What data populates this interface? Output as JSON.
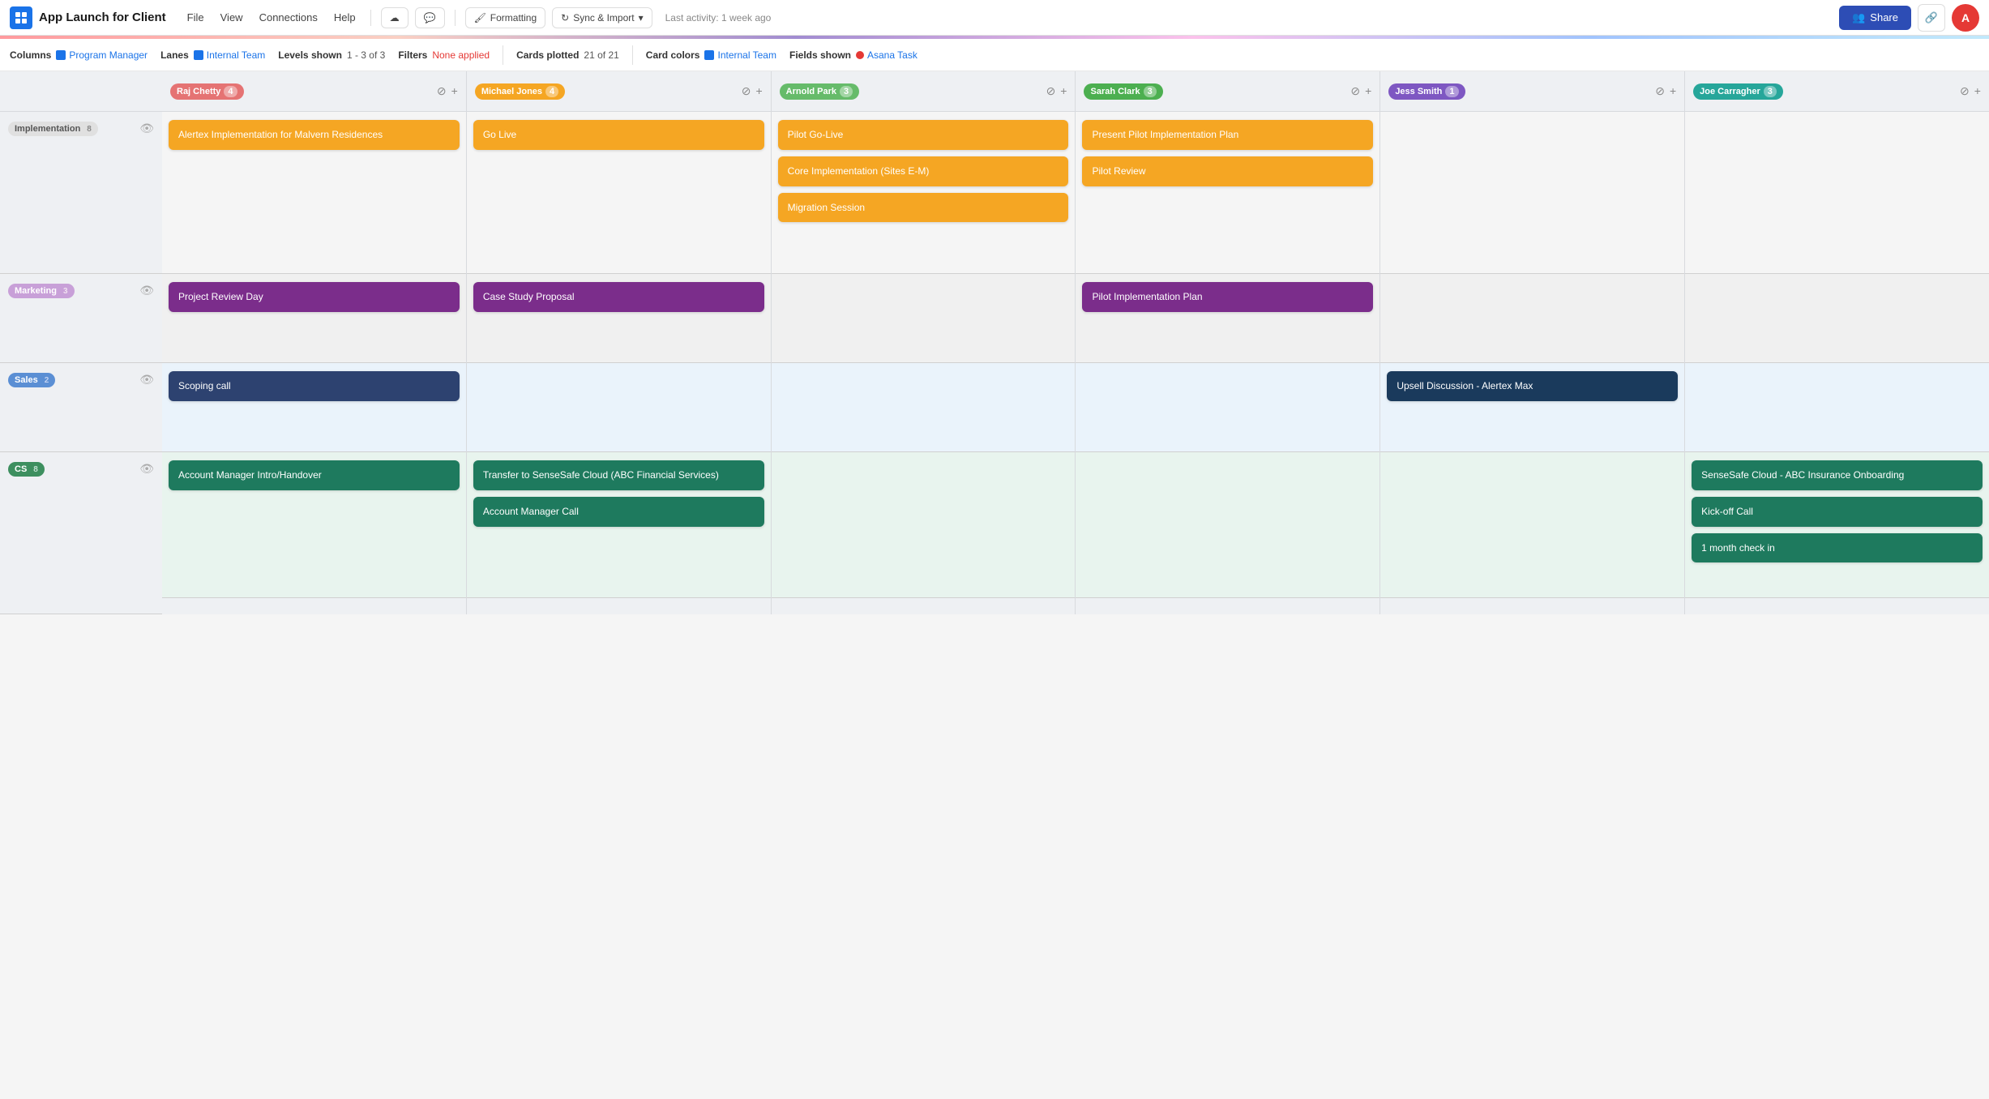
{
  "app": {
    "logo_text": "A",
    "title": "App Launch for Client",
    "menu": [
      "File",
      "View",
      "Connections",
      "Help"
    ],
    "formatting_btn": "Formatting",
    "sync_btn": "Sync & Import",
    "last_activity": "Last activity:  1 week ago",
    "share_btn": "Share",
    "avatar": "A"
  },
  "toolbar": {
    "columns_label": "Columns",
    "columns_value": "Program Manager",
    "lanes_label": "Lanes",
    "lanes_value": "Internal Team",
    "levels_label": "Levels shown",
    "levels_value": "1 - 3 of 3",
    "filters_label": "Filters",
    "filters_value": "None applied",
    "cards_label": "Cards plotted",
    "cards_value": "21 of 21",
    "card_colors_label": "Card colors",
    "card_colors_value": "Internal Team",
    "fields_label": "Fields shown",
    "fields_value": "Asana Task"
  },
  "columns": [
    {
      "id": "raj",
      "name": "Raj Chetty",
      "count": 4,
      "badge_class": "badge-raj"
    },
    {
      "id": "michael",
      "name": "Michael Jones",
      "count": 4,
      "badge_class": "badge-michael"
    },
    {
      "id": "arnold",
      "name": "Arnold Park",
      "count": 3,
      "badge_class": "badge-arnold"
    },
    {
      "id": "sarah",
      "name": "Sarah Clark",
      "count": 3,
      "badge_class": "badge-sarah"
    },
    {
      "id": "jess",
      "name": "Jess Smith",
      "count": 1,
      "badge_class": "badge-jess"
    },
    {
      "id": "joe",
      "name": "Joe Carragher",
      "count": 3,
      "badge_class": "badge-joe"
    }
  ],
  "lanes": [
    {
      "id": "implementation",
      "label": "Implementation",
      "count": 8,
      "tag_class": "tag-impl"
    },
    {
      "id": "marketing",
      "label": "Marketing",
      "count": 3,
      "tag_class": "tag-mkt"
    },
    {
      "id": "sales",
      "label": "Sales",
      "count": 2,
      "tag_class": "tag-sales"
    },
    {
      "id": "cs",
      "label": "CS",
      "count": 8,
      "tag_class": "tag-cs"
    }
  ],
  "cells": {
    "implementation": {
      "raj": [
        {
          "text": "Alertex Implementation for Malvern Residences",
          "color": "orange"
        }
      ],
      "michael": [
        {
          "text": "Go Live",
          "color": "orange"
        }
      ],
      "arnold": [
        {
          "text": "Pilot Go-Live",
          "color": "orange"
        },
        {
          "text": "Core Implementation (Sites E-M)",
          "color": "orange"
        },
        {
          "text": "Migration Session",
          "color": "orange"
        }
      ],
      "sarah": [
        {
          "text": "Present Pilot Implementation Plan",
          "color": "orange"
        },
        {
          "text": "Pilot Review",
          "color": "orange"
        }
      ],
      "jess": [],
      "joe": []
    },
    "marketing": {
      "raj": [
        {
          "text": "Project Review Day",
          "color": "purple"
        }
      ],
      "michael": [
        {
          "text": "Case Study Proposal",
          "color": "purple"
        }
      ],
      "arnold": [],
      "sarah": [
        {
          "text": "Pilot Implementation Plan",
          "color": "purple"
        }
      ],
      "jess": [],
      "joe": []
    },
    "sales": {
      "raj": [
        {
          "text": "Scoping call",
          "color": "navy"
        }
      ],
      "michael": [],
      "arnold": [],
      "sarah": [],
      "jess": [
        {
          "text": "Upsell Discussion - Alertex Max",
          "color": "dark-blue"
        }
      ],
      "joe": []
    },
    "cs": {
      "raj": [
        {
          "text": "Account Manager Intro/Handover",
          "color": "teal"
        }
      ],
      "michael": [
        {
          "text": "Transfer to SenseSafe Cloud (ABC Financial Services)",
          "color": "teal"
        },
        {
          "text": "Account Manager Call",
          "color": "teal"
        }
      ],
      "arnold": [],
      "sarah": [],
      "jess": [],
      "joe": [
        {
          "text": "SenseSafe Cloud - ABC Insurance Onboarding",
          "color": "teal"
        },
        {
          "text": "Kick-off Call",
          "color": "teal"
        },
        {
          "text": "1 month check in",
          "color": "teal"
        }
      ]
    }
  }
}
